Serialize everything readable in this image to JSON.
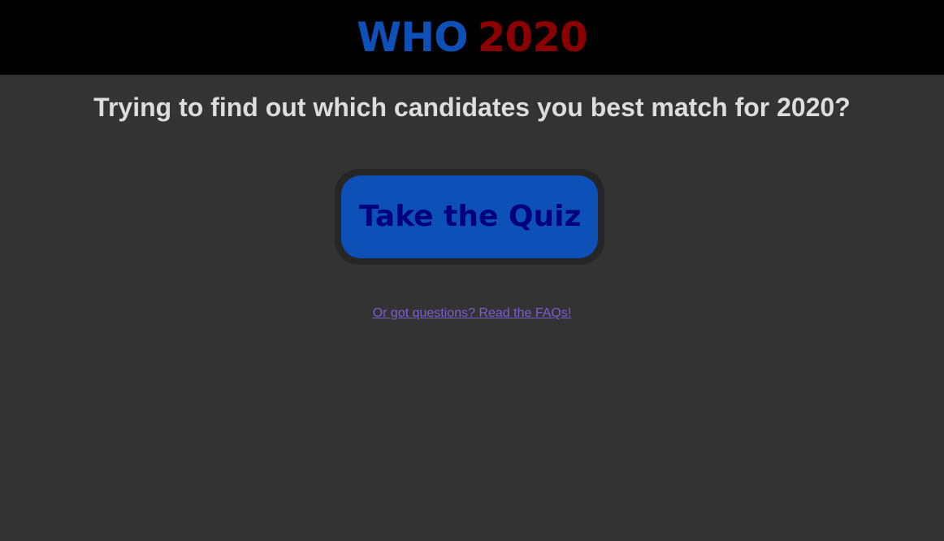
{
  "header": {
    "logo_word": "WHO",
    "logo_year": "2020"
  },
  "main": {
    "tagline": "Trying to find out which candidates you best match for 2020?",
    "quiz_button_label": "Take the Quiz",
    "faq_link_text": "Or got questions? Read the FAQs!"
  },
  "colors": {
    "header_bg": "#000000",
    "page_bg": "#333333",
    "logo_who": "#0d50b8",
    "logo_year": "#8b0000",
    "button_bg": "#0d50b8",
    "button_text": "#00007a",
    "link": "#7a5fd0",
    "tagline_text": "#dddddd"
  }
}
